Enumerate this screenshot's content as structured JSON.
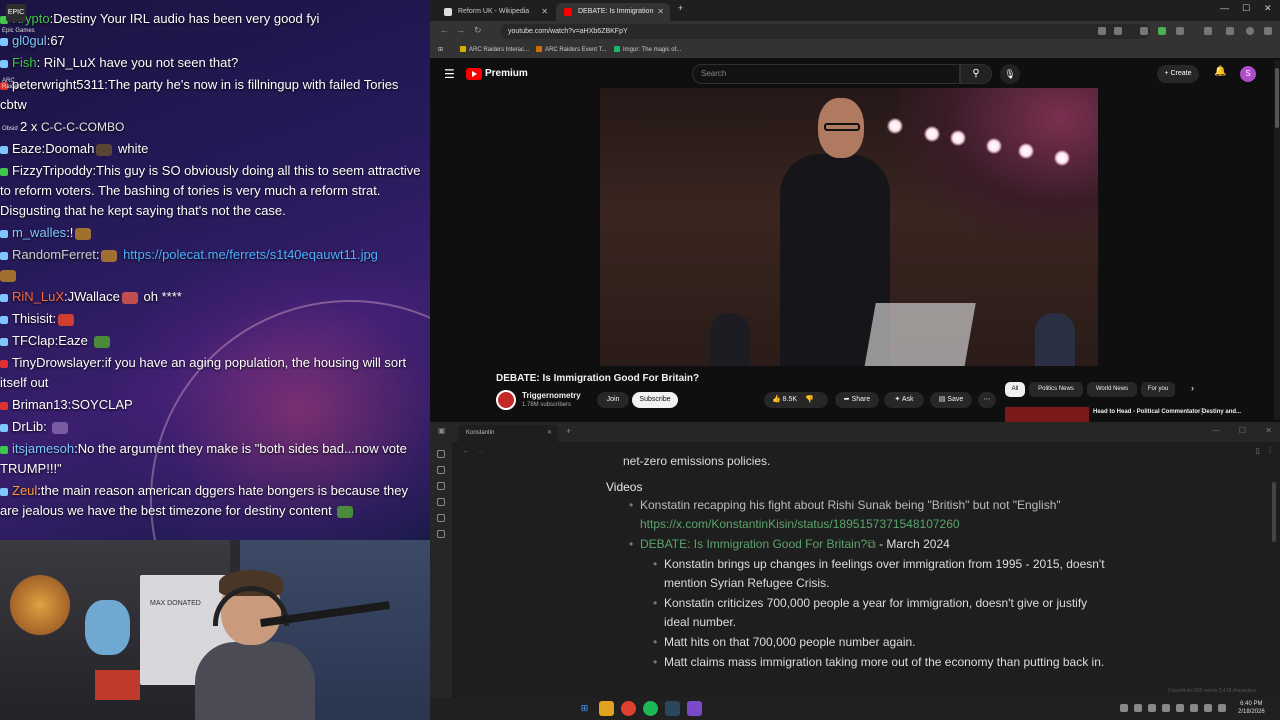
{
  "chat": {
    "side_icons": [
      "EPIC",
      "Epic Games",
      "ARC Raiders",
      "Obsid"
    ],
    "messages": [
      {
        "user": "Krypto",
        "user_color": "#3ec94a",
        "text": ":Destiny Your IRL audio has been very good fyi"
      },
      {
        "user": "gl0gul",
        "user_color": "#7ec8ff",
        "text": ":67"
      },
      {
        "user": "Fish",
        "user_color": "#3ec94a",
        "text": ": RiN_LuX have you not seen that?"
      },
      {
        "user": "peterwright5311",
        "user_color": "#ffffff",
        "text": ":The party he's now in is fillningup with failed Tories cbtw"
      },
      {
        "user": "",
        "user_color": "#ffffff",
        "text": "2 x",
        "combo": "C-C-C-COMBO"
      },
      {
        "user": "Eaze",
        "user_color": "#ffffff",
        "text": ":Doomah",
        "after": "white"
      },
      {
        "user": "FizzyTripoddy",
        "user_color": "#ffffff",
        "text": ":This guy is SO obviously doing all this to seem attractive to reform voters. The bashing of tories is very much a reform strat. Disgusting that he kept saying that's not the case."
      },
      {
        "user": "m_walles",
        "user_color": "#7ec8ff",
        "text": ":!"
      },
      {
        "user": "RandomFerret",
        "user_color": "#d0d0d0",
        "text": ":",
        "link": "https://polecat.me/ferrets/s1t40eqauwt11.jpg"
      },
      {
        "user": "RiN_LuX",
        "user_color": "#ff6a3d",
        "text": ":JWallace",
        "after": "oh ****"
      },
      {
        "user": "Thisisit",
        "user_color": "#ffffff",
        "text": ":"
      },
      {
        "user": "TFClap",
        "user_color": "#ffffff",
        "text": ":Eaze"
      },
      {
        "user": "TinyDrowslayer",
        "user_color": "#ffffff",
        "text": ":if you have an aging population, the housing will sort itself out"
      },
      {
        "user": "Briman13",
        "user_color": "#ffffff",
        "text": ":SOYCLAP"
      },
      {
        "user": "DrLib",
        "user_color": "#ffffff",
        "text": ":"
      },
      {
        "user": "itsjamesoh",
        "user_color": "#7ec8ff",
        "text": ":No the argument they make is \"both sides bad...now vote TRUMP!!!\""
      },
      {
        "user": "Zeul",
        "user_color": "#ff9a3d",
        "text": ":the main reason american dggers hate bongers is because they are jealous we have the best timezone for destiny content"
      }
    ]
  },
  "webcam": {
    "panel_text": "MAX DONATED"
  },
  "browser": {
    "tabs": [
      {
        "label": "Reform UK - Wikipedia",
        "active": false
      },
      {
        "label": "DEBATE: Is Immigration Go...",
        "active": true
      }
    ],
    "url": "youtube.com/watch?v=aHXb6ZBKFpY",
    "bookmarks": [
      "ARC Raiders Interac...",
      "ARC Raiders Event T...",
      "Imgur: The magic of..."
    ],
    "new_tab": "+"
  },
  "youtube": {
    "brand": "Premium",
    "search_placeholder": "Search",
    "create_label": "+ Create",
    "avatar_letter": "S",
    "video_title": "DEBATE: Is Immigration Good For Britain?",
    "channel": "Triggernometry",
    "subscribers": "1.78M subscribers",
    "join": "Join",
    "subscribe": "Subscribe",
    "likes": "8.5K",
    "share": "Share",
    "ask": "Ask",
    "save": "Save",
    "chips": [
      "All",
      "Politics News",
      "World News",
      "For you"
    ],
    "rec_title": "Head to Head - Political Commentator Destiny and..."
  },
  "obsidian": {
    "tab": "Konstantin",
    "intro": "net-zero emissions policies.",
    "heading": "Videos",
    "item1": "Konstatin recapping his fight about Rishi Sunak being \"British\" but not \"English\"",
    "item1_link": "https://x.com/KonstantinKisin/status/1895157371548107260",
    "item2_link": "DEBATE: Is Immigration Good For Britain?",
    "item2_date": " - March 2024",
    "sub": [
      "Konstatin brings up changes in feelings over immigration from 1995 - 2015, doesn't mention Syrian Refugee Crisis.",
      "Konstatin criticizes 700,000 people a year for immigration, doesn't give or justify ideal number.",
      "Matt hits on that 700,000 people number again.",
      "Matt claims mass immigration taking more out of the economy than putting back in."
    ],
    "status": "0 backlinks  556 words  3,418 characters"
  },
  "taskbar": {
    "time": "6:40 PM",
    "date": "2/18/2026"
  },
  "colors": {
    "accent": "#ff0000",
    "obsidian_link": "#5ba46a",
    "chat_link": "#4fb0ff"
  }
}
